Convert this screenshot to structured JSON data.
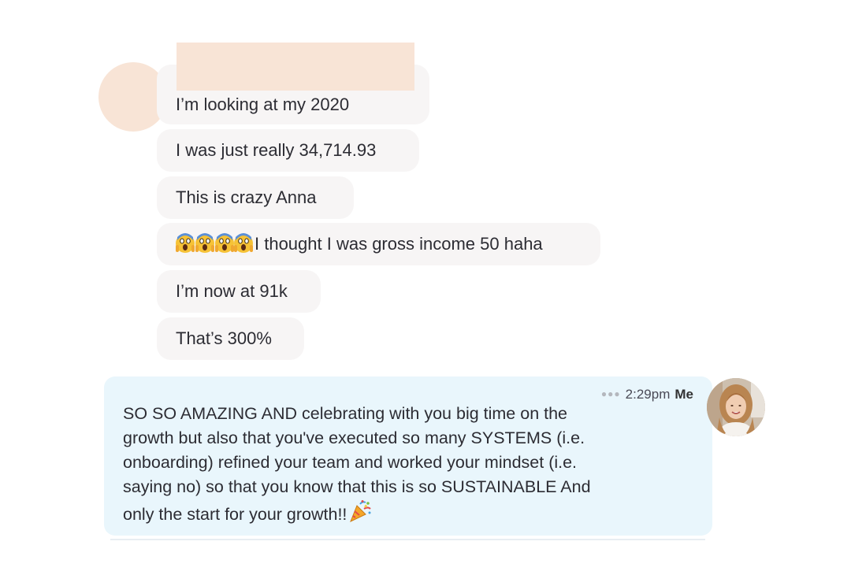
{
  "conversation": {
    "received_messages": [
      {
        "text": "I’m looking at my 2020"
      },
      {
        "text": "I was just really 34,714.93"
      },
      {
        "text": "This is crazy Anna"
      },
      {
        "emoji": "😱😱😱😱",
        "text": "I thought I was gross income 50 haha"
      },
      {
        "text": "I’m now at 91k"
      },
      {
        "text": "That’s 300%"
      }
    ],
    "sent_message": {
      "status_icon": "typing-dots-icon",
      "time": "2:29pm",
      "sender": "Me",
      "text": "SO SO AMAZING AND celebrating with you big time on the\ngrowth but also that you've executed so many SYSTEMS (i.e.\nonboarding) refined your team and worked your mindset (i.e.\nsaying no) so that you know that this is so SUSTAINABLE And\nonly the start for your growth!!",
      "emoji": "🎉"
    }
  },
  "colors": {
    "received_bubble": "#f7f5f5",
    "sent_bubble": "#e9f6fc",
    "redaction": "#f8e4d6"
  }
}
